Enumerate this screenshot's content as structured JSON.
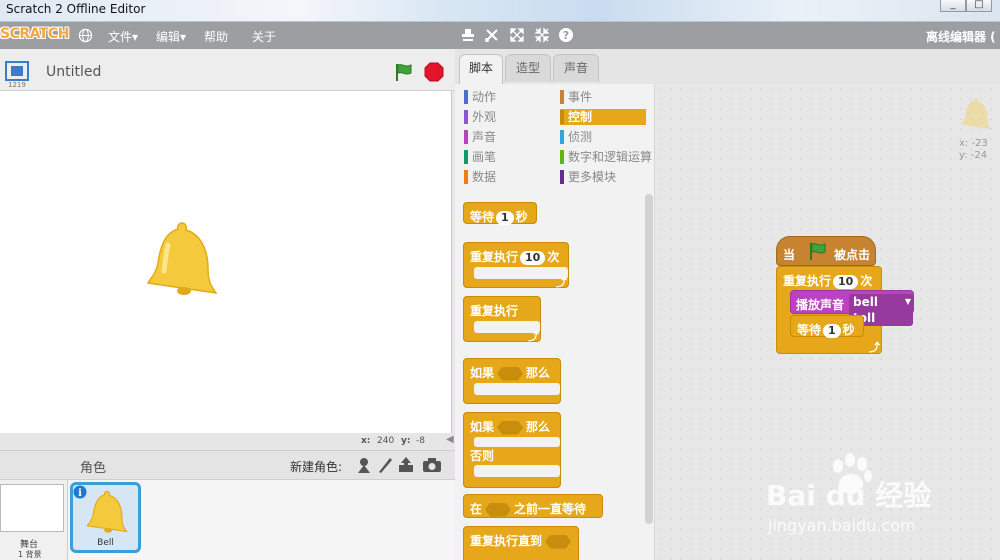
{
  "window": {
    "title": "Scratch 2 Offline Editor",
    "min_label": "_",
    "max_label": "□"
  },
  "menubar": {
    "logo": "SCRATCH",
    "items": [
      "文件▾",
      "编辑▾",
      "帮助",
      "关于"
    ],
    "right_label": "离线编辑器 ("
  },
  "stage": {
    "version": "1219",
    "project_title": "Untitled",
    "coord_x_label": "x:",
    "coord_x": "240",
    "coord_y_label": "y:",
    "coord_y": "-8"
  },
  "sprites_panel": {
    "title": "角色",
    "new_sprite_label": "新建角色:",
    "stage_label": "舞台",
    "stage_backdrops": "1 背景",
    "sprite_name": "Bell"
  },
  "tabs": [
    "脚本",
    "造型",
    "声音"
  ],
  "categories": {
    "left": [
      {
        "label": "动作",
        "color": "#4a6cd4"
      },
      {
        "label": "外观",
        "color": "#8a55d7"
      },
      {
        "label": "声音",
        "color": "#bb42c3"
      },
      {
        "label": "画笔",
        "color": "#0e9a6c"
      },
      {
        "label": "数据",
        "color": "#ee7d16"
      }
    ],
    "right": [
      {
        "label": "事件",
        "color": "#c88330"
      },
      {
        "label": "控制",
        "color": "#e1a91a",
        "active": true
      },
      {
        "label": "侦测",
        "color": "#2ca5e2"
      },
      {
        "label": "数字和逻辑运算",
        "color": "#5cb712"
      },
      {
        "label": "更多模块",
        "color": "#632d99"
      }
    ]
  },
  "palette": {
    "wait_a": "等待",
    "wait_val": "1",
    "wait_b": "秒",
    "repeat_a": "重复执行",
    "repeat_val": "10",
    "repeat_b": "次",
    "forever": "重复执行",
    "if_a": "如果",
    "if_b": "那么",
    "ifelse_a": "如果",
    "ifelse_b": "那么",
    "ifelse_else": "否则",
    "waituntil_a": "在",
    "waituntil_b": "之前一直等待",
    "repeatuntil": "重复执行直到"
  },
  "script": {
    "hat_a": "当",
    "hat_b": "被点击",
    "repeat_a": "重复执行",
    "repeat_val": "10",
    "repeat_b": "次",
    "sound_label": "播放声音",
    "sound_value": "bell toll",
    "wait_a": "等待",
    "wait_val": "1",
    "wait_b": "秒"
  },
  "sprite_info": {
    "x": "x: -23",
    "y": "y: -24"
  },
  "watermark": {
    "brand": "Bai du 经验",
    "url": "jingyan.baidu.com"
  },
  "colors": {
    "control": "#e6a81a",
    "events": "#c88330",
    "sound": "#bb42c3",
    "menubar": "#9c9ea2"
  }
}
